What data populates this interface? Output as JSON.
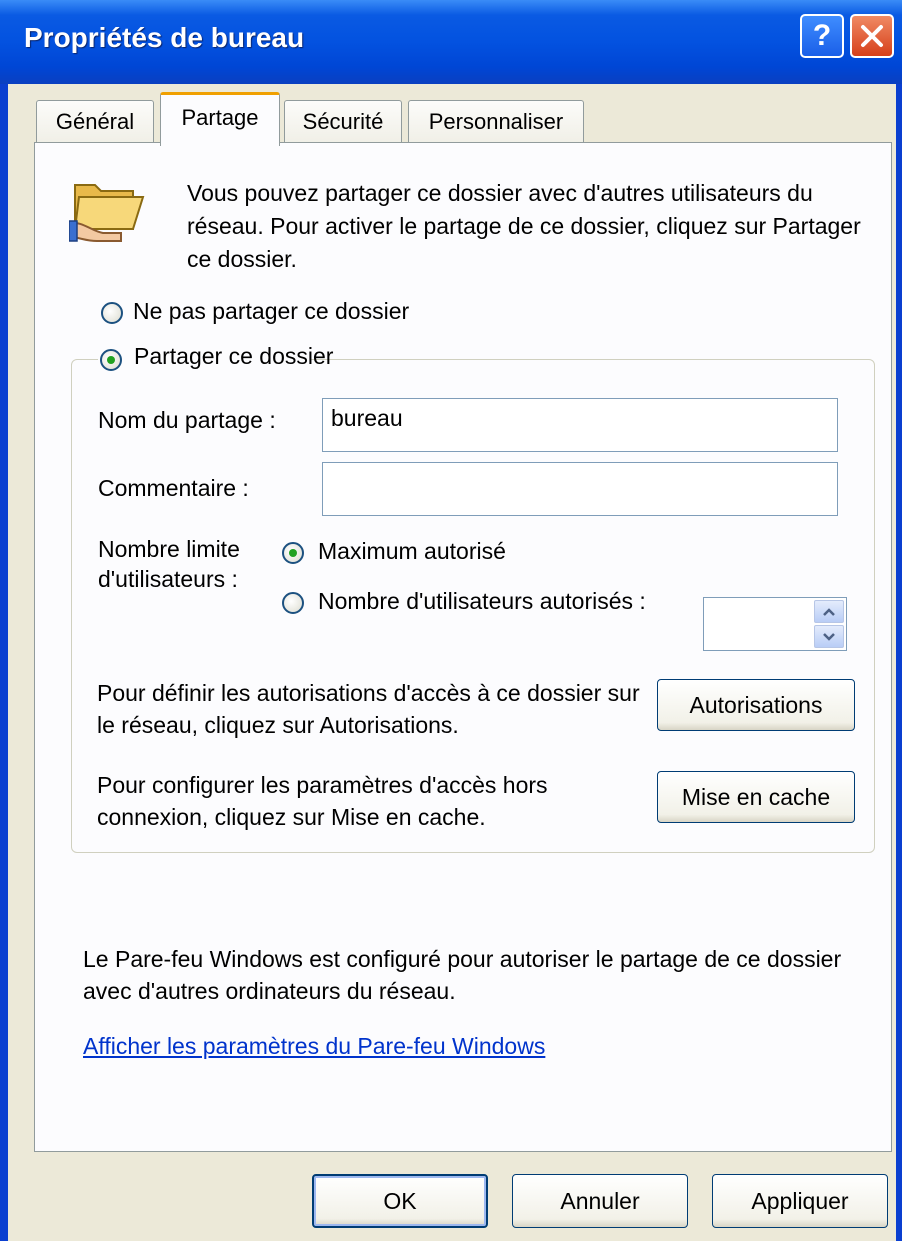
{
  "window": {
    "title": "Propriétés de bureau"
  },
  "titlebar": {
    "help_label": "?",
    "help_icon": "help-icon",
    "close_icon": "close-icon"
  },
  "tabs": [
    {
      "label": "Général",
      "active": false
    },
    {
      "label": "Partage",
      "active": true
    },
    {
      "label": "Sécurité",
      "active": false
    },
    {
      "label": "Personnaliser",
      "active": false
    }
  ],
  "sharing": {
    "intro": "Vous pouvez partager ce dossier avec d'autres utilisateurs du réseau. Pour activer le partage de ce dossier, cliquez sur Partager ce dossier.",
    "icon": "shared-folder-icon",
    "radio_no_share": {
      "label": "Ne pas partager ce dossier",
      "checked": false
    },
    "radio_share": {
      "label": "Partager ce dossier",
      "checked": true
    },
    "share_name_label": "Nom du partage :",
    "share_name_value": "bureau",
    "comment_label": "Commentaire :",
    "comment_value": "",
    "user_limit_label_line1": "Nombre limite",
    "user_limit_label_line2": "d'utilisateurs :",
    "radio_max": {
      "label": "Maximum autorisé",
      "checked": true
    },
    "radio_count": {
      "label": "Nombre d'utilisateurs autorisés :",
      "checked": false
    },
    "user_count_value": "",
    "permissions_text": "Pour définir les autorisations d'accès à ce dossier sur le réseau, cliquez sur Autorisations.",
    "permissions_button": "Autorisations",
    "cache_text": "Pour configurer les paramètres d'accès hors connexion, cliquez sur Mise en cache.",
    "cache_button": "Mise en cache"
  },
  "firewall": {
    "text": "Le Pare-feu Windows est configuré pour autoriser le partage de ce dossier avec d'autres ordinateurs du réseau.",
    "link": "Afficher les paramètres du Pare-feu Windows"
  },
  "footer": {
    "ok": "OK",
    "cancel": "Annuler",
    "apply": "Appliquer"
  },
  "colors": {
    "titlebar": "#0352e0",
    "tab_highlight": "#f0a000",
    "radio_dot": "#21a121",
    "link": "#0033cc"
  }
}
